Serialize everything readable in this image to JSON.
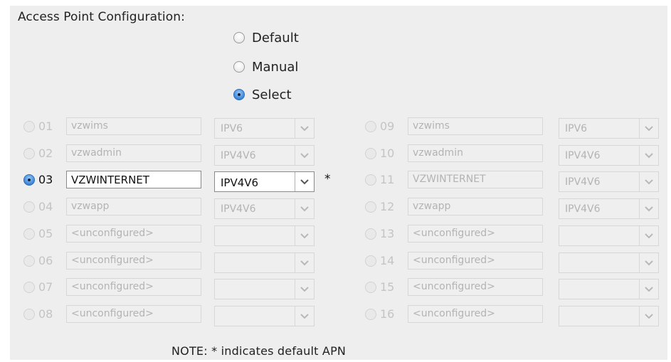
{
  "section_title": "Access Point Configuration:",
  "mode": {
    "options": [
      {
        "label": "Default",
        "selected": false
      },
      {
        "label": "Manual",
        "selected": false
      },
      {
        "label": "Select",
        "selected": true
      }
    ]
  },
  "apn_rows": [
    {
      "num": "01",
      "name": "vzwims",
      "ip": "IPV6",
      "active": false,
      "default": false
    },
    {
      "num": "02",
      "name": "vzwadmin",
      "ip": "IPV4V6",
      "active": false,
      "default": false
    },
    {
      "num": "03",
      "name": "VZWINTERNET",
      "ip": "IPV4V6",
      "active": true,
      "default": true
    },
    {
      "num": "04",
      "name": "vzwapp",
      "ip": "IPV4V6",
      "active": false,
      "default": false
    },
    {
      "num": "05",
      "name": "<unconfigured>",
      "ip": "",
      "active": false,
      "default": false
    },
    {
      "num": "06",
      "name": "<unconfigured>",
      "ip": "",
      "active": false,
      "default": false
    },
    {
      "num": "07",
      "name": "<unconfigured>",
      "ip": "",
      "active": false,
      "default": false
    },
    {
      "num": "08",
      "name": "<unconfigured>",
      "ip": "",
      "active": false,
      "default": false
    },
    {
      "num": "09",
      "name": "vzwims",
      "ip": "IPV6",
      "active": false,
      "default": false
    },
    {
      "num": "10",
      "name": "vzwadmin",
      "ip": "IPV4V6",
      "active": false,
      "default": false
    },
    {
      "num": "11",
      "name": "VZWINTERNET",
      "ip": "IPV4V6",
      "active": false,
      "default": false
    },
    {
      "num": "12",
      "name": "vzwapp",
      "ip": "IPV4V6",
      "active": false,
      "default": false
    },
    {
      "num": "13",
      "name": "<unconfigured>",
      "ip": "",
      "active": false,
      "default": false
    },
    {
      "num": "14",
      "name": "<unconfigured>",
      "ip": "",
      "active": false,
      "default": false
    },
    {
      "num": "15",
      "name": "<unconfigured>",
      "ip": "",
      "active": false,
      "default": false
    },
    {
      "num": "16",
      "name": "<unconfigured>",
      "ip": "",
      "active": false,
      "default": false
    }
  ],
  "default_marker": "*",
  "note": "NOTE: * indicates default APN",
  "colors": {
    "panel_bg": "#eeeeee",
    "radio_selected": "#3a7fd0",
    "disabled_text": "#b3b3b3"
  },
  "icons": {
    "dropdown": "chevron-down-icon",
    "radio": "radio-button-icon"
  }
}
